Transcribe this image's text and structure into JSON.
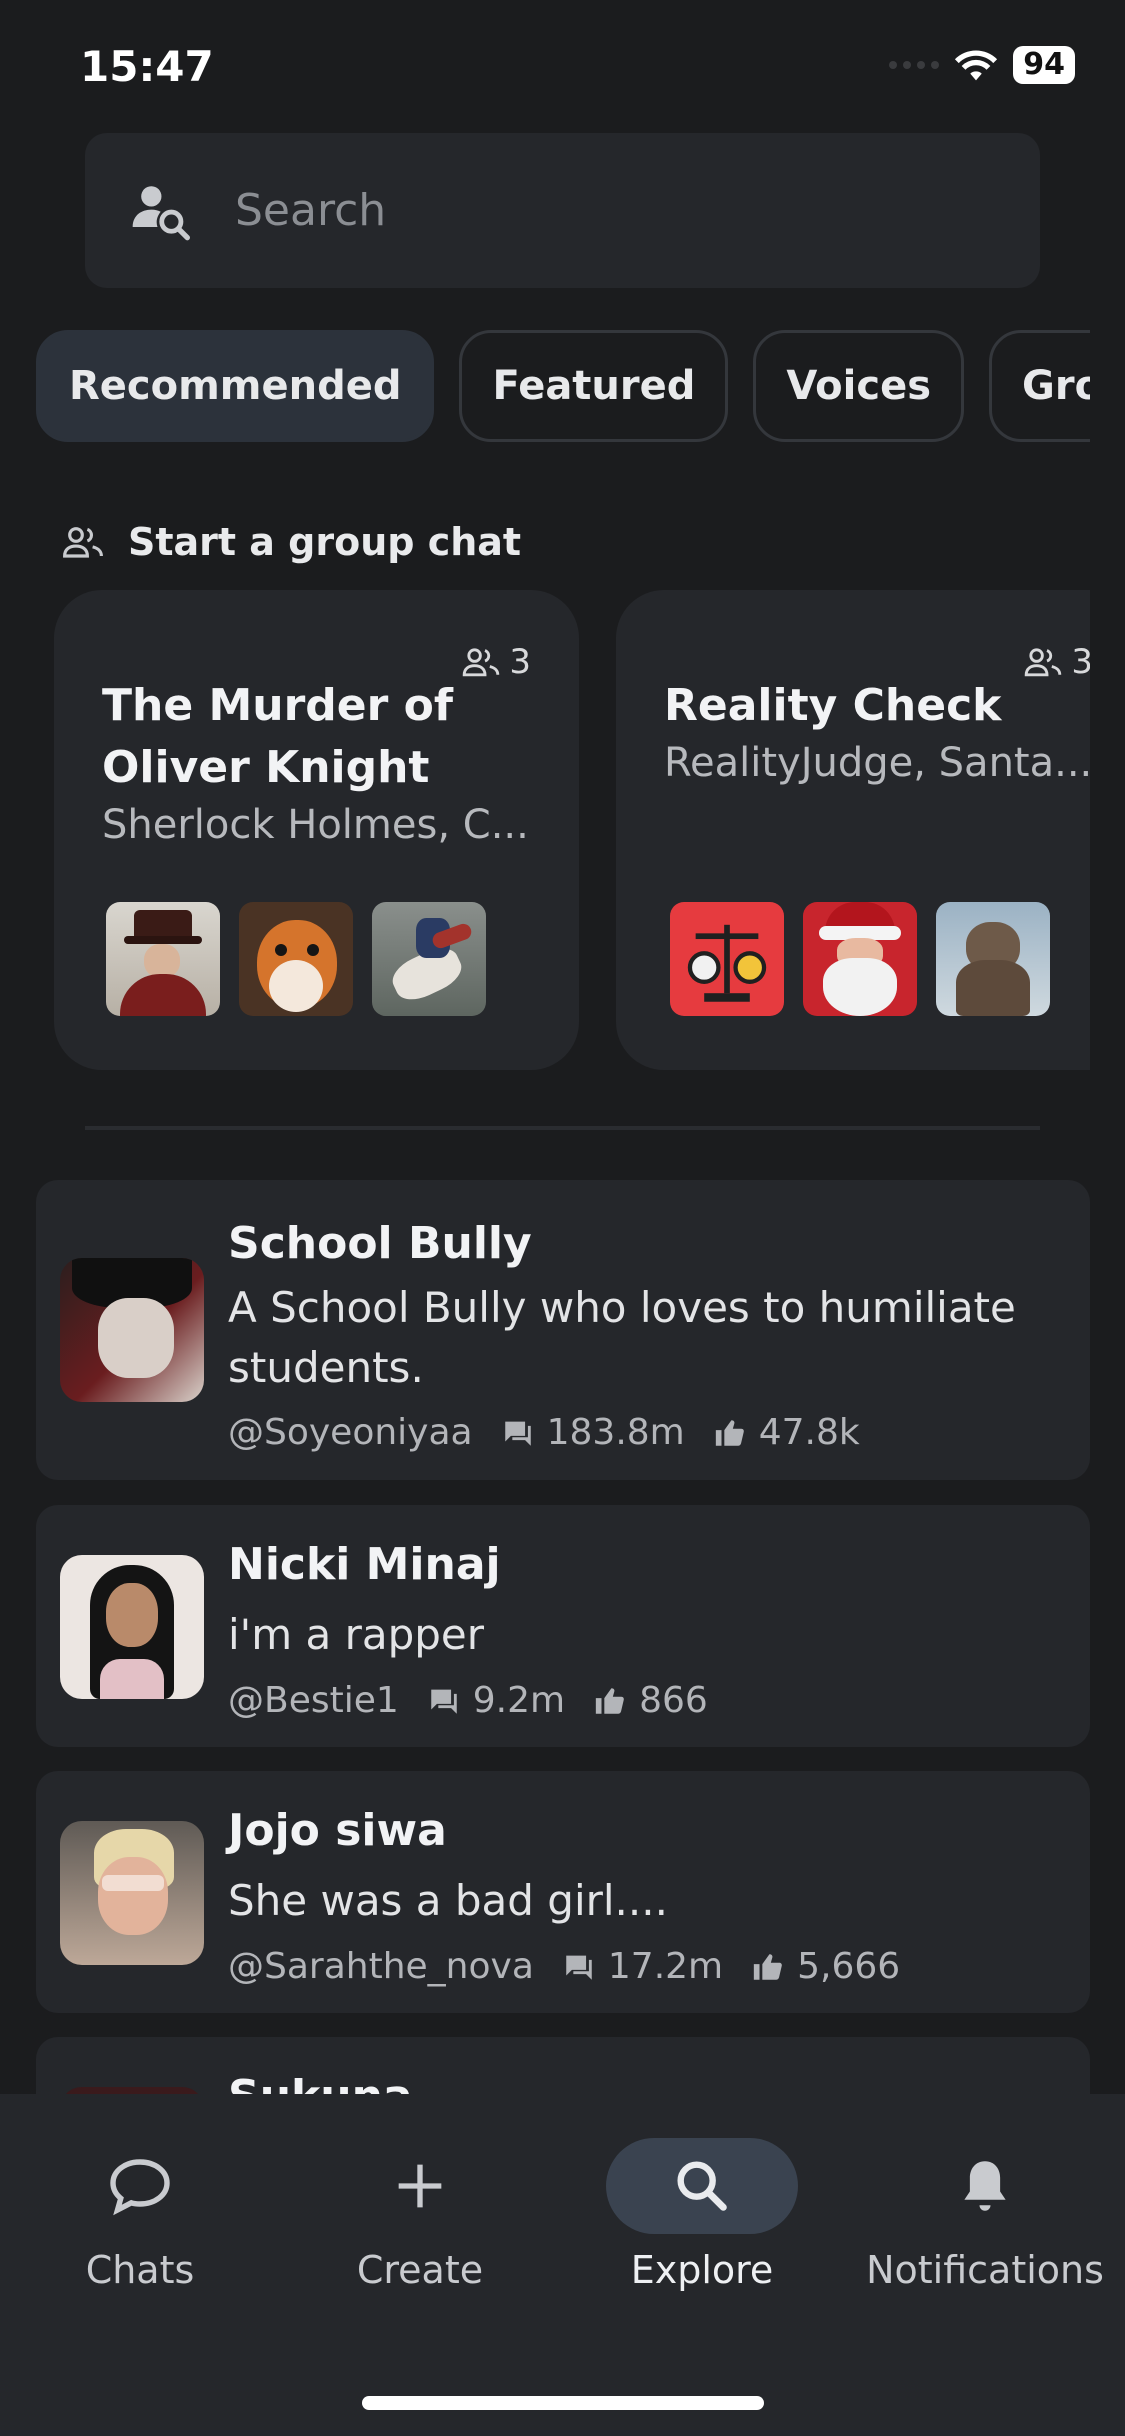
{
  "status": {
    "time": "15:47",
    "battery": "94"
  },
  "search": {
    "placeholder": "Search"
  },
  "tabs": [
    "Recommended",
    "Featured",
    "Voices",
    "Groups"
  ],
  "section": {
    "title": "Start a group chat"
  },
  "groups": [
    {
      "title": "The Murder of Oliver Knight",
      "members": "Sherlock Holmes, C...",
      "count": "3"
    },
    {
      "title": "Reality Check",
      "members": "RealityJudge, Santa...",
      "count": "3"
    }
  ],
  "characters": [
    {
      "name": "School Bully",
      "description": "A School Bully who loves to humiliate students.",
      "author": "@Soyeoniyaa",
      "chats": "183.8m",
      "likes": "47.8k"
    },
    {
      "name": "Nicki Minaj",
      "description": "i'm a rapper",
      "author": "@Bestie1",
      "chats": "9.2m",
      "likes": "866"
    },
    {
      "name": "Jojo siwa",
      "description": "She was a bad girl....",
      "author": "@Sarahthe_nova",
      "chats": "17.2m",
      "likes": "5,666"
    },
    {
      "name": "Sukuna"
    }
  ],
  "nav": {
    "chats": "Chats",
    "create": "Create",
    "explore": "Explore",
    "notifications": "Notifications"
  },
  "colors": {
    "background": "#1b1c1e",
    "card": "#25272b",
    "active_tab": "#2c323b",
    "active_nav": "#3a4350"
  }
}
